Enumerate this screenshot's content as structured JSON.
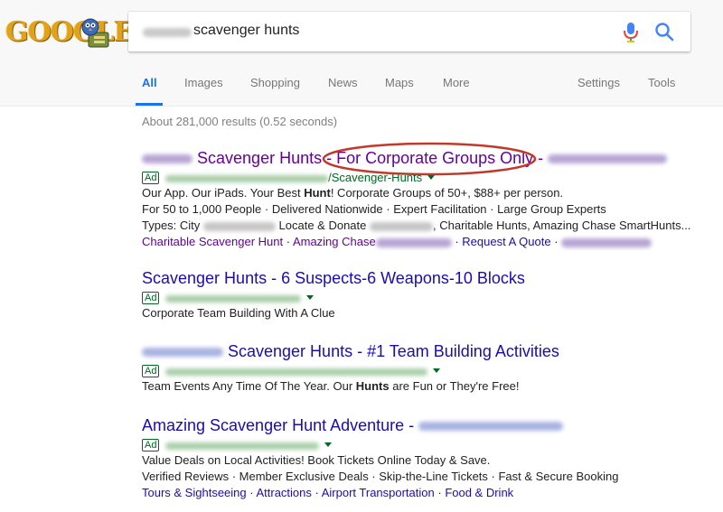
{
  "logo": {
    "text": "GOOGLE"
  },
  "search": {
    "query": "scavenger hunts"
  },
  "tabs": [
    {
      "label": "All"
    },
    {
      "label": "Images"
    },
    {
      "label": "Shopping"
    },
    {
      "label": "News"
    },
    {
      "label": "Maps"
    },
    {
      "label": "More"
    },
    {
      "label": "Settings"
    },
    {
      "label": "Tools"
    }
  ],
  "stats": "About 281,000 results (0.52 seconds)",
  "results": [
    {
      "title_main": "Scavenger Hunts",
      "title_rest": " - For Corporate Groups Only - ",
      "ad_label": "Ad",
      "url_tail": "/Scavenger-Hunts",
      "line1_pre": "Our App. Our iPads. Your Best ",
      "line1_bold": "Hunt",
      "line1_post": "! Corporate Groups of 50+, $88+ per person.",
      "line2": "For 50 to 1,000 People · Delivered Nationwide · Expert Facilitation · Large Group Experts",
      "line3_a": "Types: City",
      "line3_b": " Locate & Donate",
      "line3_c": ", Charitable Hunts, Amazing Chase SmartHunts...",
      "sitelinks": [
        "Charitable Scavenger Hunt",
        "Amazing Chase",
        "Request A Quote"
      ]
    },
    {
      "title": "Scavenger Hunts - 6 Suspects-6 Weapons-10 Blocks",
      "ad_label": "Ad",
      "line1": "Corporate Team Building With A Clue"
    },
    {
      "title": " Scavenger Hunts - #1 Team Building Activities",
      "ad_label": "Ad",
      "line1_pre": "Team Events Any Time Of The Year. Our ",
      "line1_bold": "Hunts",
      "line1_post": " are Fun or They're Free!"
    },
    {
      "title": "Amazing Scavenger Hunt Adventure - ",
      "ad_label": "Ad",
      "line1": "Value Deals on Local Activities! Book Tickets Online Today & Save.",
      "line2": "Verified Reviews · Member Exclusive Deals · Skip-the-Line Tickets · Fast & Secure Booking",
      "sitelinks": [
        "Tours & Sightseeing",
        "Attractions",
        "Airport Transportation",
        "Food & Drink"
      ]
    }
  ],
  "colors": {
    "link": "#1a0dab",
    "visited": "#660099",
    "url_green": "#006621",
    "accent_blue": "#1a73e8",
    "annotation_red": "#c0392b"
  }
}
